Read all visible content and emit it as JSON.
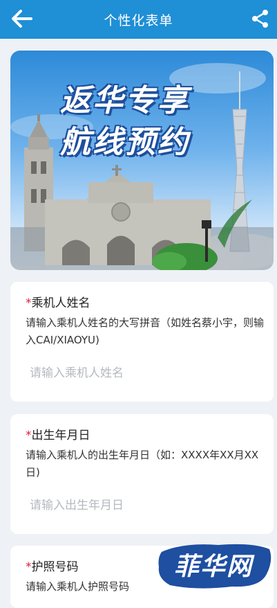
{
  "header": {
    "title": "个性化表单"
  },
  "banner": {
    "line1": "返华专享",
    "line2": "航线预约"
  },
  "fields": [
    {
      "required_mark": "*",
      "label": "乘机人姓名",
      "description": "请输入乘机人姓名的大写拼音（如姓名蔡小宇，则输入CAI/XIAOYU)",
      "placeholder": "请输入乘机人姓名",
      "value": ""
    },
    {
      "required_mark": "*",
      "label": "出生年月日",
      "description": "请输入乘机人的出生年月日（如：XXXX年XX月XX日)",
      "placeholder": "请输入出生年月日",
      "value": ""
    },
    {
      "required_mark": "*",
      "label": "护照号码",
      "description": "请输入乘机人护照号码",
      "placeholder": "",
      "value": ""
    }
  ],
  "watermark": {
    "text": "菲华网"
  },
  "colors": {
    "header": "#1f8fd6",
    "required": "#d81e3a",
    "watermark": "#1e4fa0"
  },
  "icons": {
    "back": "arrow-left-icon",
    "share": "share-icon"
  }
}
